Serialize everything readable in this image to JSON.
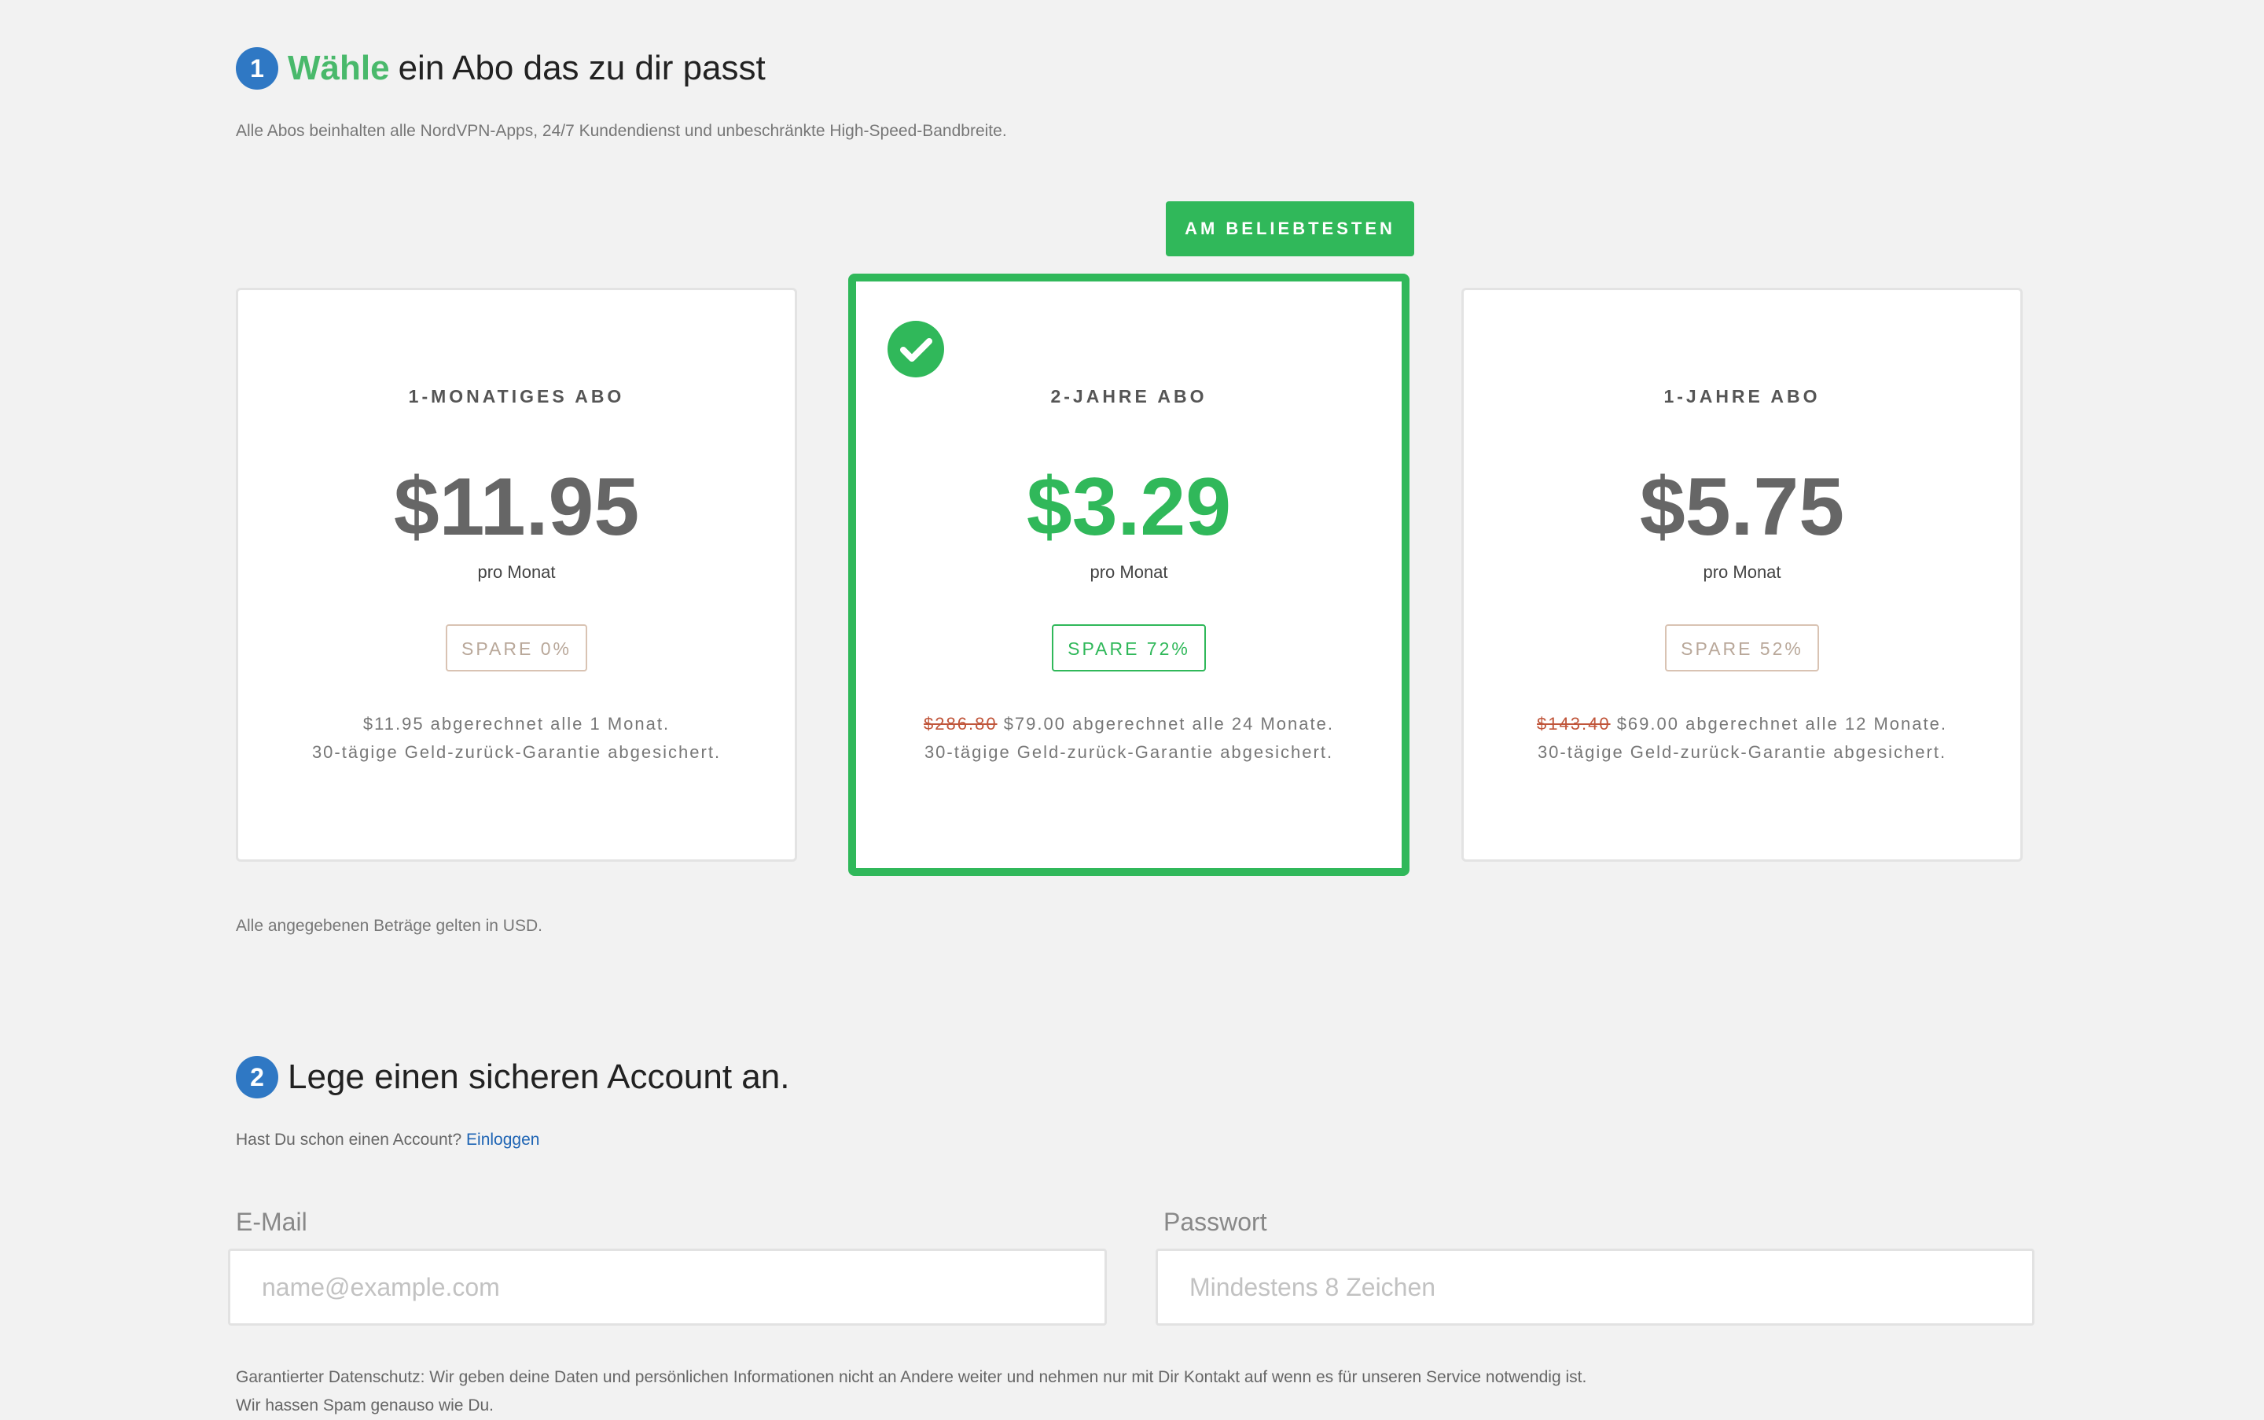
{
  "step1": {
    "number": "1",
    "title_accent": "Wähle",
    "title_rest": "ein Abo das zu dir passt",
    "subtitle": "Alle Abos beinhalten alle NordVPN-Apps, 24/7 Kundendienst und unbeschränkte High-Speed-Bandbreite."
  },
  "popular_badge": "AM BELIEBTESTEN",
  "plans": [
    {
      "name": "1-MONATIGES ABO",
      "price": "$11.95",
      "per": "pro Monat",
      "save": "SPARE 0%",
      "old_price": "",
      "billing": "$11.95 abgerechnet alle 1 Monat.",
      "guarantee": "30-tägige Geld-zurück-Garantie abgesichert.",
      "selected": false
    },
    {
      "name": "2-JAHRE ABO",
      "price": "$3.29",
      "per": "pro Monat",
      "save": "SPARE 72%",
      "old_price": "$286.80",
      "billing": "$79.00 abgerechnet alle 24 Monate.",
      "guarantee": "30-tägige Geld-zurück-Garantie abgesichert.",
      "selected": true
    },
    {
      "name": "1-JAHRE ABO",
      "price": "$5.75",
      "per": "pro Monat",
      "save": "SPARE 52%",
      "old_price": "$143.40",
      "billing": "$69.00 abgerechnet alle 12 Monate.",
      "guarantee": "30-tägige Geld-zurück-Garantie abgesichert.",
      "selected": false
    }
  ],
  "currency_note": "Alle angegebenen Beträge gelten in USD.",
  "step2": {
    "number": "2",
    "title": "Lege einen sicheren Account an.",
    "account_prompt": "Hast Du schon einen Account?",
    "login_link": "Einloggen"
  },
  "form": {
    "email_label": "E-Mail",
    "email_placeholder": "name@example.com",
    "email_value": "",
    "password_label": "Passwort",
    "password_placeholder": "Mindestens 8 Zeichen",
    "password_value": ""
  },
  "privacy": {
    "line1": "Garantierter Datenschutz: Wir geben deine Daten und persönlichen Informationen nicht an Andere weiter und nehmen nur mit Dir Kontakt auf wenn es für unseren Service notwendig ist.",
    "line2": "Wir hassen Spam genauso wie Du."
  },
  "colors": {
    "accent_green": "#30b85a",
    "step_blue": "#2f78c4",
    "link_blue": "#1e64b4",
    "strike_red": "#c0553a"
  }
}
